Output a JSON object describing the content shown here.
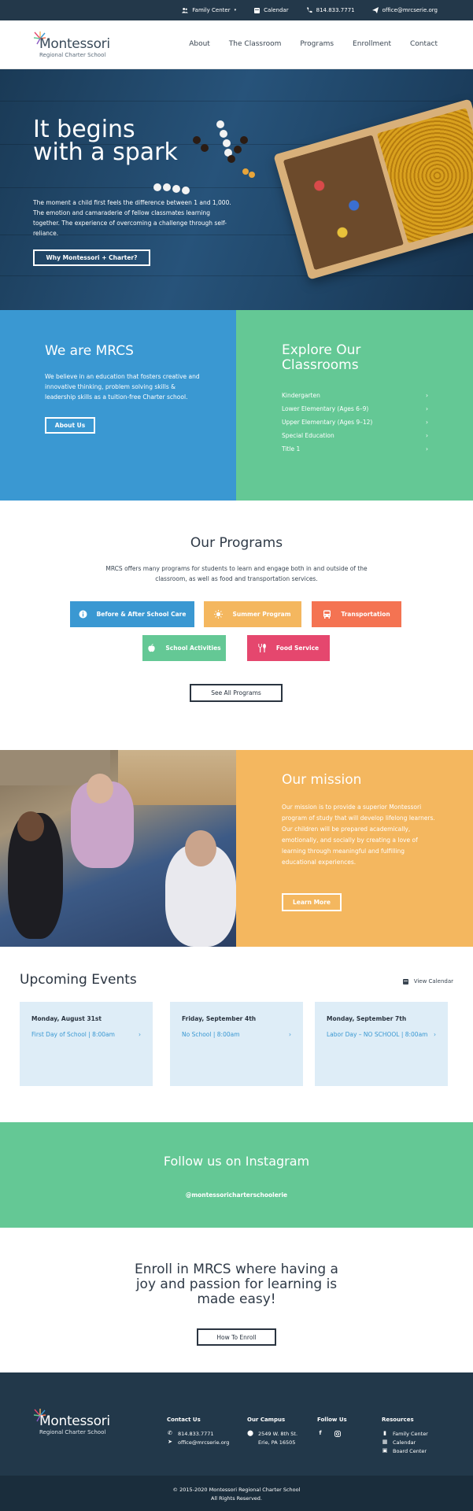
{
  "topbar": {
    "family_center": "Family Center",
    "calendar": "Calendar",
    "phone": "814.833.7771",
    "email": "office@mrcserie.org"
  },
  "header": {
    "logo_line1": "Montessori",
    "logo_line2": "Regional Charter School",
    "nav": [
      "About",
      "The Classroom",
      "Programs",
      "Enrollment",
      "Contact"
    ]
  },
  "hero": {
    "title": "It begins with a spark",
    "body": "The moment a child first feels the difference between 1 and 1,000. The emotion and camaraderie of fellow classmates learning together. The experience of overcoming a challenge through self-reliance.",
    "button": "Why Montessori + Charter?"
  },
  "about": {
    "title": "We are MRCS",
    "body": "We believe in an education that fosters creative and innovative thinking, problem solving skills & leadership skills as a tuition-free Charter school.",
    "button": "About Us"
  },
  "classrooms": {
    "title": "Explore Our Classrooms",
    "items": [
      "Kindergarten",
      "Lower Elementary (Ages 6–9)",
      "Upper Elementary (Ages 9–12)",
      "Special Education",
      "Title 1"
    ]
  },
  "programs": {
    "title": "Our Programs",
    "body": "MRCS offers many programs for students to learn and engage both in and outside of the classroom, as well as food and transportation services.",
    "items": [
      {
        "label": "Before & After School Care",
        "color": "#3a98d2",
        "icon": "info-icon"
      },
      {
        "label": "Summer Program",
        "color": "#f4b75f",
        "icon": "sun-icon"
      },
      {
        "label": "Transportation",
        "color": "#f47352",
        "icon": "bus-icon"
      },
      {
        "label": "School Activities",
        "color": "#64c895",
        "icon": "apple-icon"
      },
      {
        "label": "Food Service",
        "color": "#e5476e",
        "icon": "utensils-icon"
      }
    ],
    "button": "See All Programs"
  },
  "mission": {
    "title": "Our mission",
    "body": "Our mission is to provide a superior Montessori program of study that will develop lifelong learners. Our children will be prepared academically, emotionally, and socially by creating a love of learning through meaningful and fulfilling educational experiences.",
    "button": "Learn More"
  },
  "events": {
    "title": "Upcoming Events",
    "view_calendar": "View Calendar",
    "items": [
      {
        "date": "Monday, August 31st",
        "event": "First Day of School | 8:00am"
      },
      {
        "date": "Friday, September 4th",
        "event": "No School | 8:00am"
      },
      {
        "date": "Monday, September 7th",
        "event": "Labor Day – NO SCHOOL | 8:00am"
      }
    ]
  },
  "instagram": {
    "title": "Follow us on Instagram",
    "handle": "@montessoricharterschoolerie"
  },
  "enroll": {
    "title": "Enroll in MRCS where having a joy and passion for learning is made easy!",
    "button": "How To Enroll"
  },
  "footer": {
    "logo_line1": "Montessori",
    "logo_line2": "Regional Charter School",
    "contact": {
      "title": "Contact Us",
      "phone": "814.833.7771",
      "email": "office@mrcserie.org"
    },
    "campus": {
      "title": "Our Campus",
      "line1": "2549 W. 8th St.",
      "line2": "Erie, PA 16505"
    },
    "follow": {
      "title": "Follow Us"
    },
    "resources": {
      "title": "Resources",
      "items": [
        "Family Center",
        "Calendar",
        "Board Center"
      ]
    },
    "copyright": "©   2015-2020 Montessori Regional Charter School",
    "rights": "All Rights Reserved."
  }
}
